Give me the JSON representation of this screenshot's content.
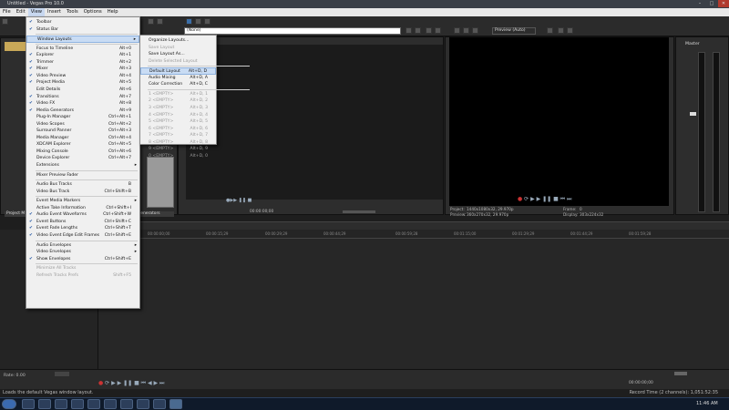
{
  "window": {
    "title": "Untitled - Vegas Pro 10.0"
  },
  "menubar": {
    "items": [
      "File",
      "Edit",
      "View",
      "Insert",
      "Tools",
      "Options",
      "Help"
    ],
    "active": "View"
  },
  "view_menu": {
    "items": [
      {
        "label": "Toolbar",
        "check": true
      },
      {
        "label": "Status Bar",
        "check": true
      },
      {
        "sep": true
      },
      {
        "label": "Window Layouts",
        "submenu": true,
        "hl": true
      },
      {
        "sep": true
      },
      {
        "label": "Focus to Timeline",
        "shortcut": "Alt+0"
      },
      {
        "label": "Explorer",
        "shortcut": "Alt+1",
        "check": true
      },
      {
        "label": "Trimmer",
        "shortcut": "Alt+2",
        "check": true
      },
      {
        "label": "Mixer",
        "shortcut": "Alt+3",
        "check": true
      },
      {
        "label": "Video Preview",
        "shortcut": "Alt+4",
        "check": true
      },
      {
        "label": "Project Media",
        "shortcut": "Alt+5",
        "check": true
      },
      {
        "label": "Edit Details",
        "shortcut": "Alt+6"
      },
      {
        "label": "Transitions",
        "shortcut": "Alt+7",
        "check": true
      },
      {
        "label": "Video FX",
        "shortcut": "Alt+8",
        "check": true
      },
      {
        "label": "Media Generators",
        "shortcut": "Alt+9",
        "check": true
      },
      {
        "label": "Plug-In Manager",
        "shortcut": "Ctrl+Alt+1"
      },
      {
        "label": "Video Scopes",
        "shortcut": "Ctrl+Alt+2"
      },
      {
        "label": "Surround Panner",
        "shortcut": "Ctrl+Alt+3"
      },
      {
        "label": "Media Manager",
        "shortcut": "Ctrl+Alt+4"
      },
      {
        "label": "XDCAM Explorer",
        "shortcut": "Ctrl+Alt+5"
      },
      {
        "label": "Mixing Console",
        "shortcut": "Ctrl+Alt+6"
      },
      {
        "label": "Device Explorer",
        "shortcut": "Ctrl+Alt+7"
      },
      {
        "label": "Extensions",
        "submenu": true
      },
      {
        "sep": true
      },
      {
        "label": "Mixer Preview Fader"
      },
      {
        "sep": true
      },
      {
        "label": "Audio Bus Tracks",
        "shortcut": "B"
      },
      {
        "label": "Video Bus Track",
        "shortcut": "Ctrl+Shift+B"
      },
      {
        "sep": true
      },
      {
        "label": "Event Media Markers",
        "submenu": true
      },
      {
        "label": "Active Take Information",
        "shortcut": "Ctrl+Shift+I"
      },
      {
        "label": "Audio Event Waveforms",
        "shortcut": "Ctrl+Shift+W",
        "check": true
      },
      {
        "label": "Event Buttons",
        "shortcut": "Ctrl+Shift+C",
        "check": true
      },
      {
        "label": "Event Fade Lengths",
        "shortcut": "Ctrl+Shift+T",
        "check": true
      },
      {
        "label": "Video Event Edge Edit Frames",
        "shortcut": "Ctrl+Shift+E",
        "check": true
      },
      {
        "sep": true
      },
      {
        "label": "Audio Envelopes",
        "submenu": true
      },
      {
        "label": "Video Envelopes",
        "submenu": true
      },
      {
        "label": "Show Envelopes",
        "shortcut": "Ctrl+Shift+E",
        "check": true
      },
      {
        "sep": true
      },
      {
        "label": "Minimize All Tracks",
        "disabled": true
      },
      {
        "label": "Refresh Tracks Prefs",
        "shortcut": "Shift+F5",
        "disabled": true
      }
    ]
  },
  "layouts_menu": {
    "items": [
      {
        "label": "Organize Layouts..."
      },
      {
        "label": "Save Layout",
        "disabled": true
      },
      {
        "label": "Save Layout As..."
      },
      {
        "label": "Delete Selected Layout",
        "disabled": true
      },
      {
        "sep": true
      },
      {
        "label": "Default Layout",
        "shortcut": "Alt+D, D",
        "hl": true
      },
      {
        "label": "Audio Mixing",
        "shortcut": "Alt+D, A"
      },
      {
        "label": "Color Correction",
        "shortcut": "Alt+D, C"
      },
      {
        "sep": true
      },
      {
        "label": "1 <EMPTY>",
        "shortcut": "Alt+D, 1",
        "disabled": true
      },
      {
        "label": "2 <EMPTY>",
        "shortcut": "Alt+D, 2",
        "disabled": true
      },
      {
        "label": "3 <EMPTY>",
        "shortcut": "Alt+D, 3",
        "disabled": true
      },
      {
        "label": "4 <EMPTY>",
        "shortcut": "Alt+D, 4",
        "disabled": true
      },
      {
        "label": "5 <EMPTY>",
        "shortcut": "Alt+D, 5",
        "disabled": true
      },
      {
        "label": "6 <EMPTY>",
        "shortcut": "Alt+D, 6",
        "disabled": true
      },
      {
        "label": "7 <EMPTY>",
        "shortcut": "Alt+D, 7",
        "disabled": true
      },
      {
        "label": "8 <EMPTY>",
        "shortcut": "Alt+D, 8",
        "disabled": true
      },
      {
        "label": "9 <EMPTY>",
        "shortcut": "Alt+D, 9",
        "disabled": true
      },
      {
        "label": "0 <EMPTY>",
        "shortcut": "Alt+D, 0",
        "disabled": true
      }
    ]
  },
  "trimmer": {
    "combo_value": "(None)",
    "timecode": "00:00:00;00"
  },
  "preview": {
    "quality": "Preview (Auto)",
    "project": "1440x1080x32, 29.970p",
    "preview_res": "360x270x32, 29.970p",
    "frame": "0",
    "display": "303x224x32",
    "project_label": "Project:",
    "preview_label": "Preview:",
    "frame_label": "Frame:",
    "display_label": "Display:"
  },
  "mixer": {
    "title": "Master"
  },
  "left_panel": {
    "tab1": "Project M",
    "tab2": "Generators"
  },
  "timeline": {
    "ruler": [
      "00:00:00;00",
      "00:00:15;29",
      "00:00:29;29",
      "00:00:44;29",
      "00:00:59;28",
      "00:01:15;00",
      "00:01:29;29",
      "00:01:44;29",
      "00:01:59;28"
    ],
    "timecode": "00:00:00;00",
    "rate": "Rate: 0.00"
  },
  "status": {
    "message": "Loads the default Vegas window layout.",
    "record_time": "Record Time (2 channels): 1,051:52:35",
    "clock": "11:46 AM"
  }
}
